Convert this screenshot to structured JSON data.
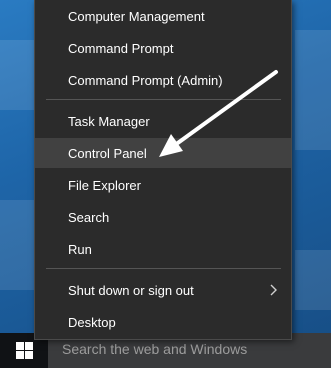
{
  "start_menu": {
    "items": [
      {
        "label": "Computer Management"
      },
      {
        "label": "Command Prompt"
      },
      {
        "label": "Command Prompt (Admin)"
      },
      {
        "label": "Task Manager"
      },
      {
        "label": "Control Panel"
      },
      {
        "label": "File Explorer"
      },
      {
        "label": "Search"
      },
      {
        "label": "Run"
      },
      {
        "label": "Shut down or sign out"
      },
      {
        "label": "Desktop"
      }
    ],
    "highlighted_item": "Control Panel"
  },
  "taskbar": {
    "search_placeholder": "Search the web and Windows",
    "start_icon": "windows-logo-icon"
  },
  "annotation": {
    "arrow_icon": "white-pointer-arrow",
    "arrow_color": "#ffffff"
  },
  "colors": {
    "menu_background": "#2b2b2b",
    "menu_highlight": "#414141",
    "taskbar": "#101215",
    "desktop_blue": "#1e65a8"
  }
}
